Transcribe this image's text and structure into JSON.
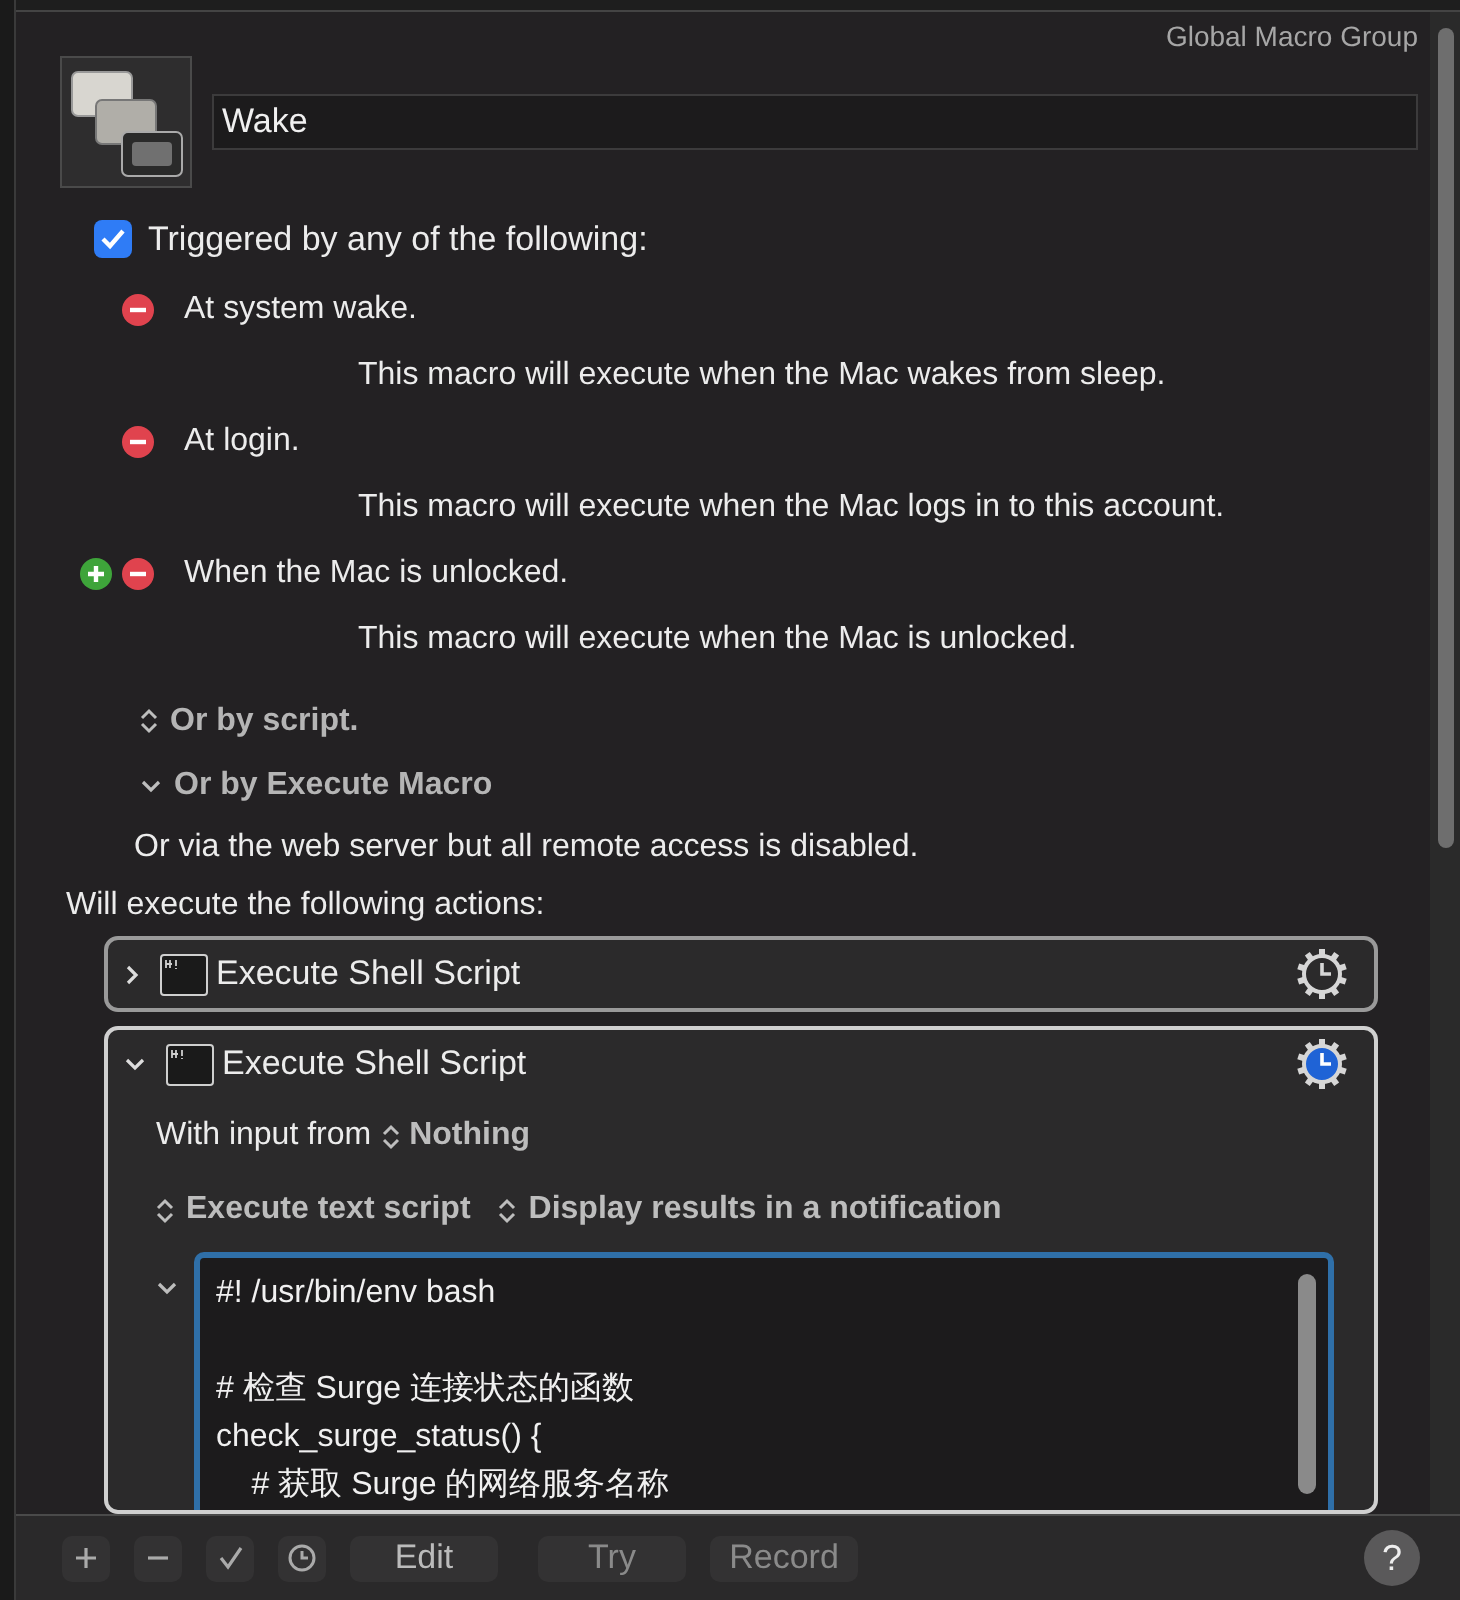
{
  "group": "Global Macro Group",
  "macro_name": "Wake",
  "trigger_header": {
    "label": "Triggered by any of the following:",
    "checked": true
  },
  "triggers": [
    {
      "title": "At system wake.",
      "description": "This macro will execute when the Mac wakes from sleep.",
      "add_button": false
    },
    {
      "title": "At login.",
      "description": "This macro will execute when the Mac logs in to this account.",
      "add_button": false
    },
    {
      "title": "When the Mac is unlocked.",
      "description": "This macro will execute when the Mac is unlocked.",
      "add_button": true
    }
  ],
  "other_triggers": [
    {
      "kind": "popup",
      "label": "Or by script."
    },
    {
      "kind": "disclosure",
      "label": "Or by Execute Macro"
    }
  ],
  "web_server_note": "Or via the web server but all remote access is disabled.",
  "actions_header": "Will execute the following actions:",
  "actions": [
    {
      "title": "Execute Shell Script",
      "expanded": false,
      "timeout_set": false
    },
    {
      "title": "Execute Shell Script",
      "expanded": true,
      "timeout_set": true,
      "input_label": "With input from",
      "input_value": "Nothing",
      "source": "Execute text script",
      "output": "Display results in a notification",
      "script_blocks": [
        [
          "#! /usr/bin/env bash"
        ],
        [
          "# 检查 Surge 连接状态的函数",
          "check_surge_status() {",
          "    # 获取 Surge 的网络服务名称"
        ]
      ]
    }
  ],
  "toolbar": {
    "edit": "Edit",
    "try": "Try",
    "record": "Record",
    "help": "?"
  }
}
